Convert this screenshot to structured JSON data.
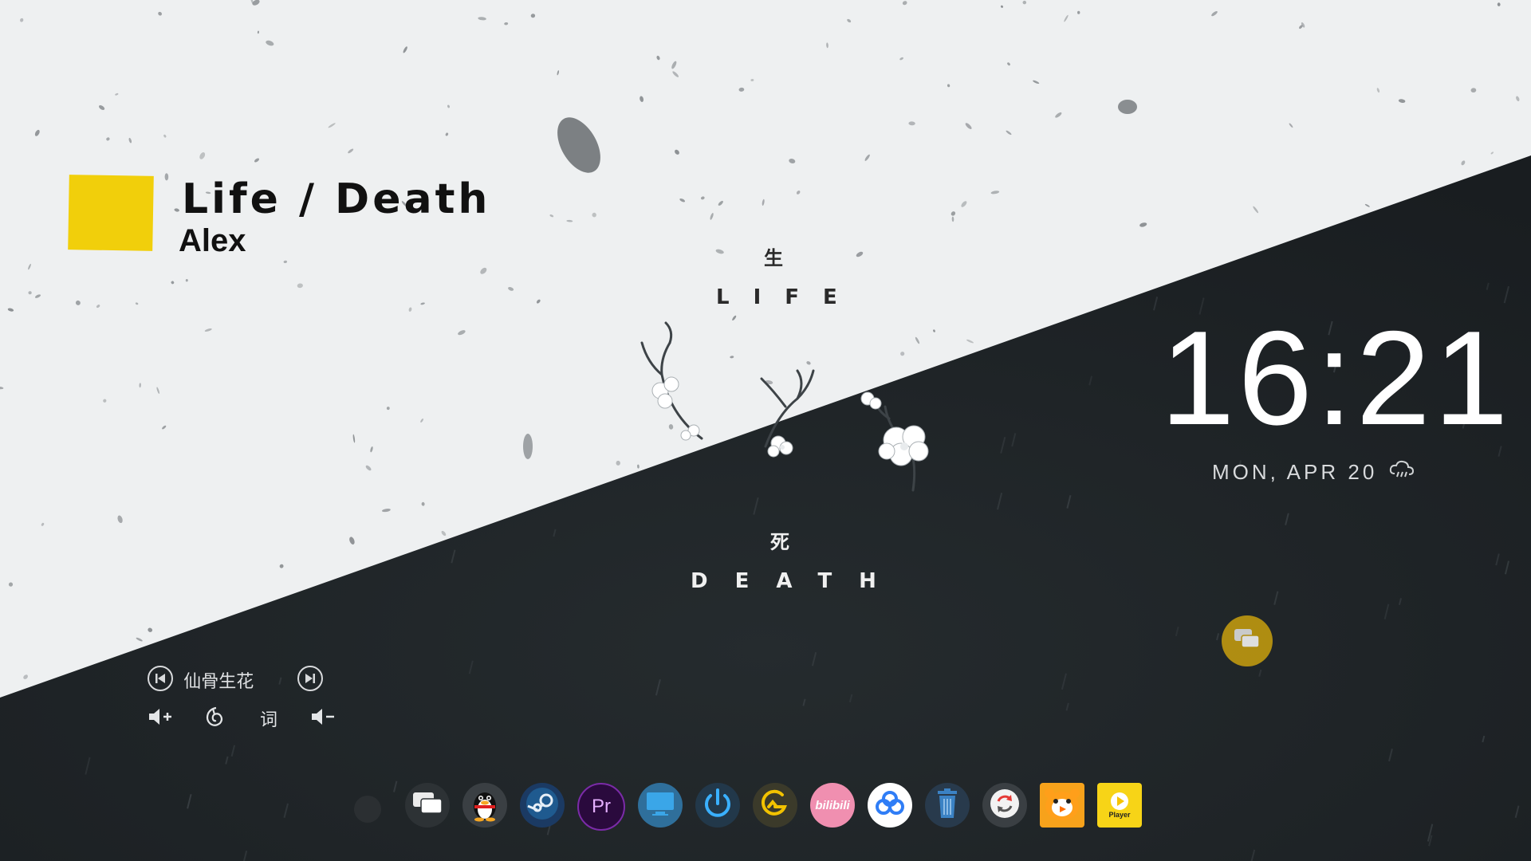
{
  "song": {
    "title": "Life / Death",
    "artist": "Alex"
  },
  "center": {
    "life_cjk": "生",
    "life_word": "LIFE",
    "death_cjk": "死",
    "death_word": "DEATH"
  },
  "clock": {
    "time": "16:21",
    "date": "MON, APR 20",
    "weather_icon": "cloud-rain-icon"
  },
  "music_controls": {
    "now_playing": "lTA 仙骨生花",
    "lyrics_button": "词",
    "buttons": [
      "previous-track-icon",
      "next-track-icon",
      "volume-up-icon",
      "netease-music-icon",
      "volume-down-icon"
    ]
  },
  "dock": {
    "items": [
      {
        "name": "messages",
        "icon": "chat-bubbles-icon"
      },
      {
        "name": "qq",
        "icon": "penguin-icon"
      },
      {
        "name": "steam",
        "icon": "steam-icon"
      },
      {
        "name": "premiere-pro",
        "icon": "premiere-icon",
        "label": "Pr"
      },
      {
        "name": "this-pc",
        "icon": "monitor-icon"
      },
      {
        "name": "shutdown",
        "icon": "power-icon"
      },
      {
        "name": "app-g",
        "icon": "g-logo-icon"
      },
      {
        "name": "bilibili",
        "icon": "bilibili-icon",
        "label": "bilibili"
      },
      {
        "name": "baidu-netdisk",
        "icon": "cloud-link-icon"
      },
      {
        "name": "recycle-bin",
        "icon": "trash-icon"
      },
      {
        "name": "sync",
        "icon": "refresh-icon"
      },
      {
        "name": "video-app",
        "icon": "tiger-icon"
      },
      {
        "name": "potplayer",
        "icon": "play-icon",
        "label": "Player"
      }
    ]
  },
  "colors": {
    "accent_yellow": "#f1cf0b",
    "dark_bg": "#1e2326",
    "light_bg": "#f1f3f4"
  }
}
